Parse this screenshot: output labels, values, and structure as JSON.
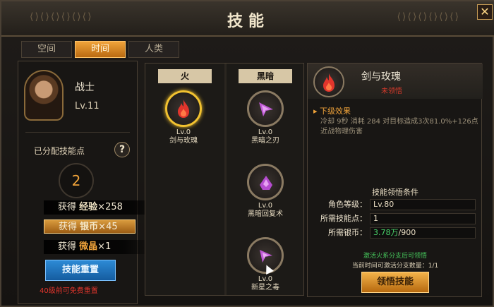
{
  "window": {
    "title": "技能",
    "close_label": "✕"
  },
  "tabs": [
    {
      "label": "空间",
      "active": false
    },
    {
      "label": "时间",
      "active": true
    },
    {
      "label": "人类",
      "active": false
    }
  ],
  "character": {
    "name": "战士",
    "level": "Lv.11",
    "allocated_label": "已分配技能点",
    "allocated_points": "2",
    "reset_button": "技能重置",
    "reset_note": "40级前可免费重置"
  },
  "rewards": [
    {
      "prefix": "获得",
      "item": "经验",
      "amount": "×258"
    },
    {
      "prefix": "获得",
      "item": "银币",
      "amount": "×45"
    },
    {
      "prefix": "获得",
      "item": "微晶",
      "amount": "×1"
    }
  ],
  "skill_tree": {
    "columns": [
      "火",
      "黑暗"
    ],
    "skills": [
      {
        "level": "Lv.0",
        "name": "剑与玫瑰",
        "icon": "fire-icon",
        "selected": true
      },
      {
        "level": "Lv.0",
        "name": "黑暗之刃",
        "icon": "dark-blade-icon",
        "selected": false
      },
      {
        "level": "Lv.0",
        "name": "黑暗回复术",
        "icon": "dark-heal-icon",
        "selected": false
      },
      {
        "level": "Lv.0",
        "name": "新星之毒",
        "icon": "nova-poison-icon",
        "selected": false
      }
    ]
  },
  "detail": {
    "name": "剑与玫瑰",
    "status": "未领悟",
    "next_effect_label": "下级效果",
    "description": "冷却 9秒  消耗 284  对目标造成3次81.0%+126点近战物理伤害",
    "conditions_title": "技能领悟条件",
    "conditions": [
      {
        "key": "角色等级：",
        "value": "Lv.80"
      },
      {
        "key": "所需技能点：",
        "value": "1"
      },
      {
        "key": "所需银币：",
        "value_have": "3.78万",
        "value_need": "/900"
      }
    ],
    "tip_activate": "激活火系分支后可领悟",
    "tip_branch": "当前时间可激活分支数量：1/1",
    "learn_button": "领悟技能"
  },
  "colors": {
    "accent": "#f0a33a",
    "fire": "#e2352c",
    "dark": "#c05ad6",
    "selected_ring": "#f2c230"
  }
}
